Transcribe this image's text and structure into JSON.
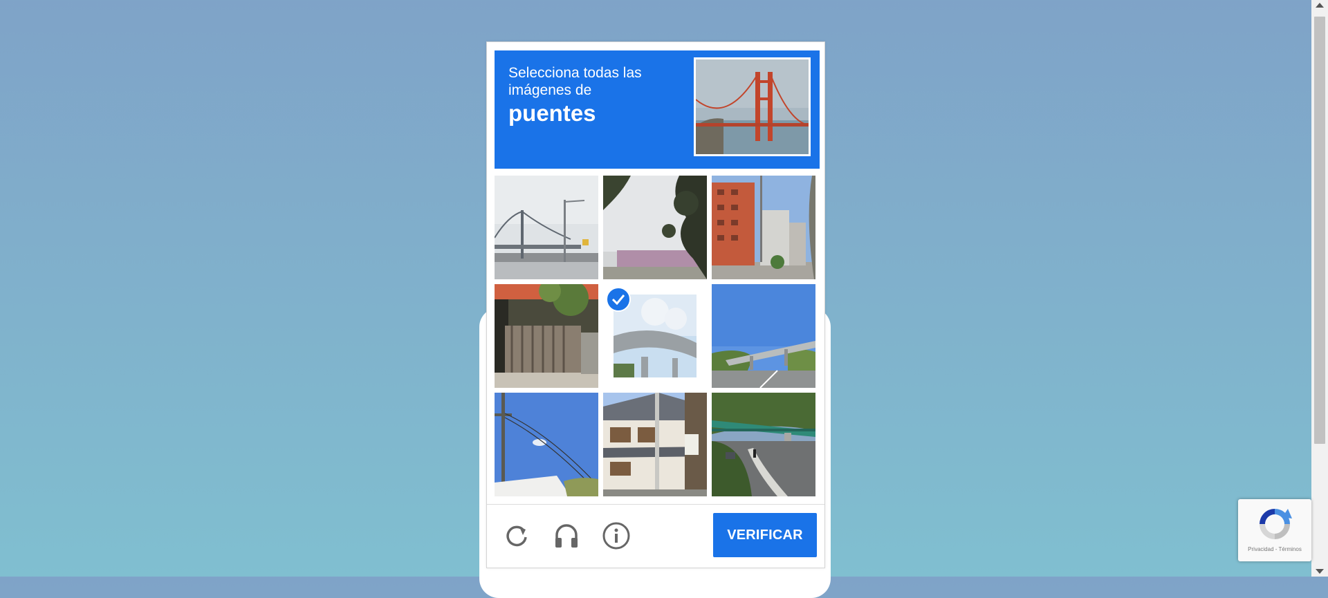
{
  "challenge": {
    "instruction_line1": "Selecciona todas las",
    "instruction_line2": "imágenes de",
    "target_word": "puentes",
    "sample_image": "golden-gate-bridge",
    "accent_color": "#1a73e8"
  },
  "grid": {
    "columns": 3,
    "rows": 3,
    "tiles": [
      {
        "image": "suspension-bridge-over-highway",
        "selected": false
      },
      {
        "image": "trees-and-wall",
        "selected": false
      },
      {
        "image": "brick-apartment-building",
        "selected": false
      },
      {
        "image": "ornate-gate-and-house",
        "selected": false
      },
      {
        "image": "curved-overpass-ramp",
        "selected": true
      },
      {
        "image": "highway-overpass",
        "selected": false
      },
      {
        "image": "sky-and-power-lines",
        "selected": false
      },
      {
        "image": "japanese-house",
        "selected": false
      },
      {
        "image": "green-bridge-over-road",
        "selected": false
      }
    ]
  },
  "footer": {
    "reload_icon": "reload-icon",
    "audio_icon": "headphones-icon",
    "info_icon": "info-icon",
    "verify_label": "VERIFICAR"
  },
  "recaptcha_badge": {
    "text": "Privacidad - Términos",
    "icon": "recaptcha-logo-icon"
  }
}
